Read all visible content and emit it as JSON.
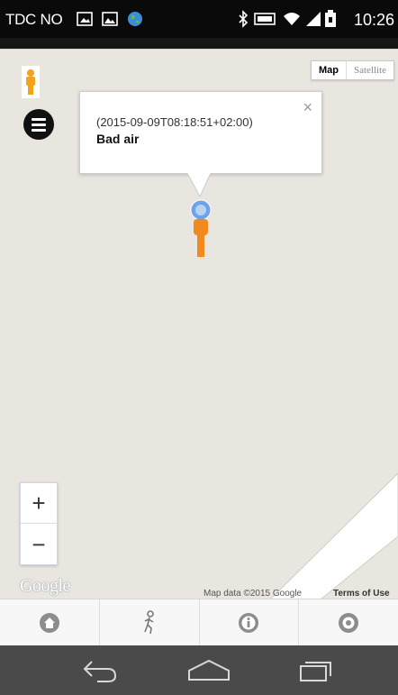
{
  "status_bar": {
    "carrier": "TDC NO",
    "time": "10:26",
    "icons": [
      "screenshot-icon",
      "image-icon",
      "globe-icon",
      "bluetooth-icon",
      "nfc-icon",
      "wifi-icon",
      "signal-icon",
      "battery-icon"
    ]
  },
  "map": {
    "type_control": {
      "map_label": "Map",
      "satellite_label": "Satellite",
      "selected": "Map"
    },
    "info_window": {
      "timestamp": "(2015-09-09T08:18:51+02:00)",
      "title": "Bad air",
      "close": "×"
    },
    "zoom": {
      "in": "+",
      "out": "−"
    },
    "logo": "Google",
    "attribution": "Map data ©2015 Google",
    "terms": "Terms of Use",
    "colors": {
      "land": "#e9e6df",
      "road": "#ffffff",
      "marker": "#f08a1c",
      "marker_dot": "#6fa2e8"
    }
  },
  "app_nav": {
    "items": [
      "home-icon",
      "walker-icon",
      "info-icon",
      "settings-icon"
    ]
  },
  "system_nav": {
    "items": [
      "back-icon",
      "home-outline-icon",
      "recents-icon"
    ]
  }
}
